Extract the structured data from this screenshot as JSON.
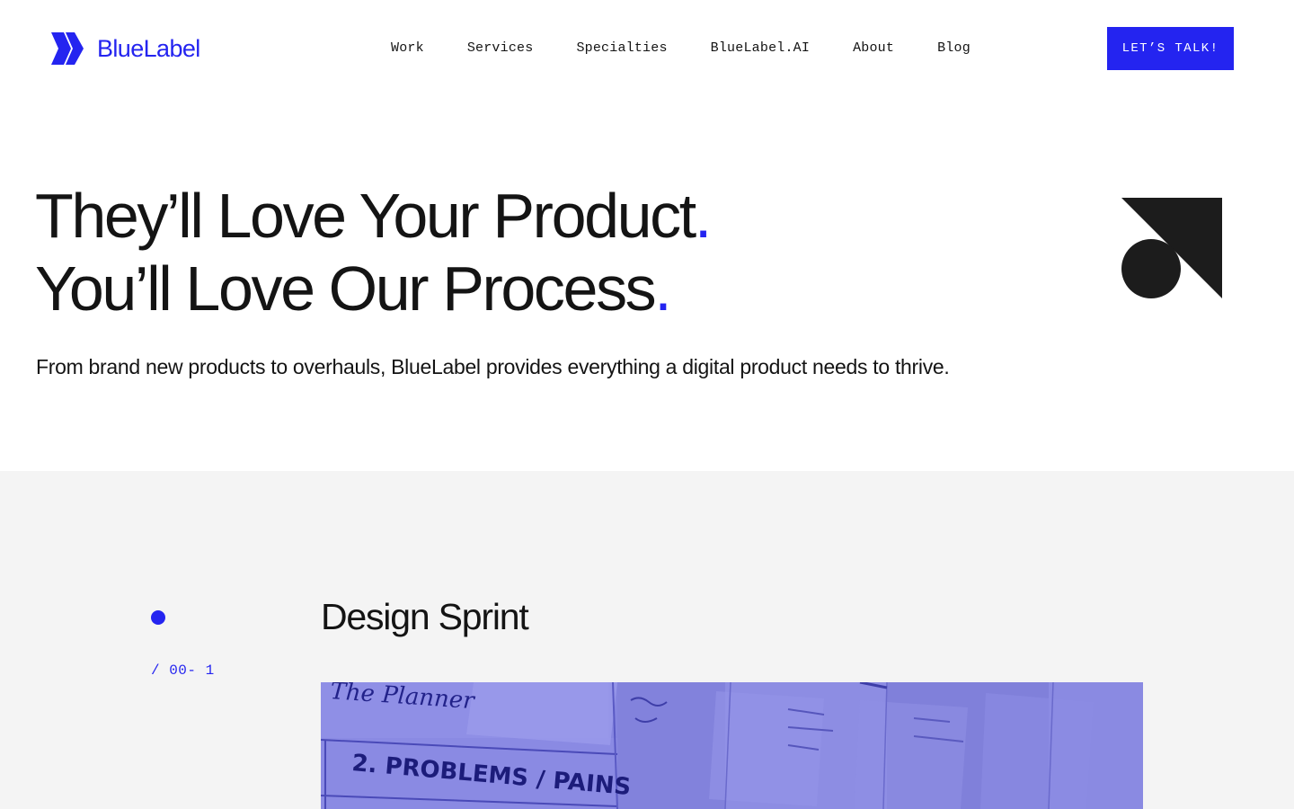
{
  "brand": {
    "name": "BlueLabel",
    "accent": "#2424f0",
    "logo_icon": "bluelabel-chevron-icon"
  },
  "nav": {
    "items": [
      {
        "label": "Work"
      },
      {
        "label": "Services"
      },
      {
        "label": "Specialties"
      },
      {
        "label": "BlueLabel.AI"
      },
      {
        "label": "About"
      },
      {
        "label": "Blog"
      }
    ],
    "cta_label": "LET’S TALK!"
  },
  "hero": {
    "title_line_1": "They’ll Love Your Product",
    "title_line_2": "You’ll Love Our Process",
    "period": ".",
    "subtitle": "From brand new products to overhauls, BlueLabel provides everything a digital product needs to thrive.",
    "art_icon": "circle-triangle-shape-icon"
  },
  "section": {
    "background": "#f4f4f4",
    "step_number": "/ 00- 1",
    "step_title": "Design Sprint",
    "image": {
      "tint": "#8585e0",
      "caption_handwritten": "The Planner",
      "caption_marker": "2. PROBLEMS / PAINS"
    }
  }
}
